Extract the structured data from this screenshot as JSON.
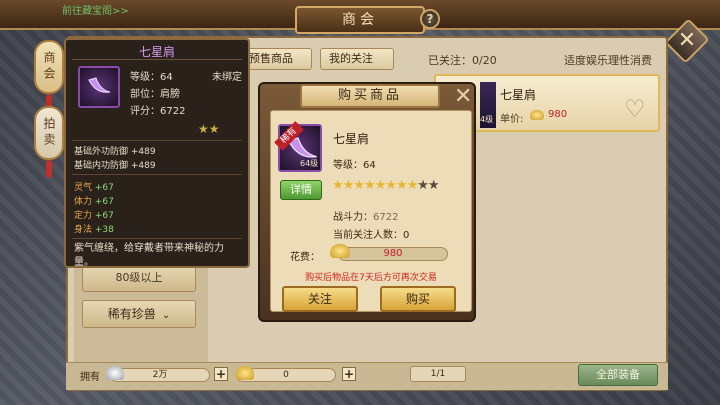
{
  "header": {
    "title": "商会",
    "help_label": "?",
    "top_link": "前往藏宝阁>>"
  },
  "side_tabs": [
    {
      "label": "商会"
    },
    {
      "label": "拍卖"
    }
  ],
  "market": {
    "tabs": [
      {
        "label": "预售商品"
      },
      {
        "label": "我的关注"
      }
    ],
    "followed": "已关注：0/20",
    "tip": "适度娱乐理性消费",
    "item_card": {
      "name": "七星肩",
      "unit_label": "单价:",
      "price": "980",
      "thumb_level": "4级"
    },
    "filters": [
      {
        "label": "80级以上"
      },
      {
        "label": "稀有珍兽",
        "chevron": "⌄"
      }
    ]
  },
  "tooltip": {
    "title": "七星肩",
    "level_label": "等级：64",
    "bind_status": "未绑定",
    "slot_label": "部位：肩膀",
    "score_label": "评分：6722",
    "stars_count": 2,
    "base_stats": [
      {
        "name": "基础外功防御",
        "value": "+489"
      },
      {
        "name": "基础内功防御",
        "value": "+489"
      }
    ],
    "attrs": [
      {
        "name": "灵气",
        "value": "+67"
      },
      {
        "name": "体力",
        "value": "+67"
      },
      {
        "name": "定力",
        "value": "+67"
      },
      {
        "name": "身法",
        "value": "+38"
      }
    ],
    "description": "紫气缠绕，给穿戴者带来神秘的力量。"
  },
  "dialog": {
    "title": "购买商品",
    "close_label": "✕",
    "item_name": "七星肩",
    "level_label": "等级：64",
    "rarity_badge": "稀有",
    "icon_level": "64级",
    "detail_label": "详情",
    "stars_total": 10,
    "stars_on": 8,
    "power_label": "战斗力：",
    "power_value": "6722",
    "fans_label": "当前关注人数：0",
    "cost_label": "花费：",
    "cost_value": "980",
    "warning": "购买后物品在7天后方可再次交易",
    "follow_label": "关注",
    "buy_label": "购买"
  },
  "bottom": {
    "own_label": "拥有",
    "silver_value": "2万",
    "gold_value": "0",
    "plus_label": "+",
    "pager": "1/1",
    "all_equip_label": "全部装备"
  },
  "colors": {
    "rare_red": "#c0202a",
    "gold_star": "#e8b830",
    "attr_orange": "#e8a84a",
    "attr_green": "#8ad87a",
    "tooltip_title": "#d89af0"
  }
}
